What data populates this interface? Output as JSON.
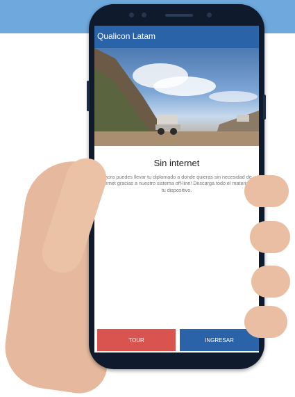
{
  "app": {
    "title": "Qualicon Latam"
  },
  "hero": {
    "image": "mining-truck-landscape"
  },
  "main": {
    "heading": "Sin internet",
    "description": "Ahora puedes llevar tu diplomado a donde quieras sin necesidad de internet gracias a nuestro sistema off-line! Descarga todo el material a tu dispositivo."
  },
  "buttons": {
    "tour": "TOUR",
    "login": "INGRESAR"
  },
  "colors": {
    "app_bar": "#2a63a8",
    "tour_button": "#d9534f",
    "login_button": "#2a63a8",
    "top_band": "#6ea8dc"
  }
}
